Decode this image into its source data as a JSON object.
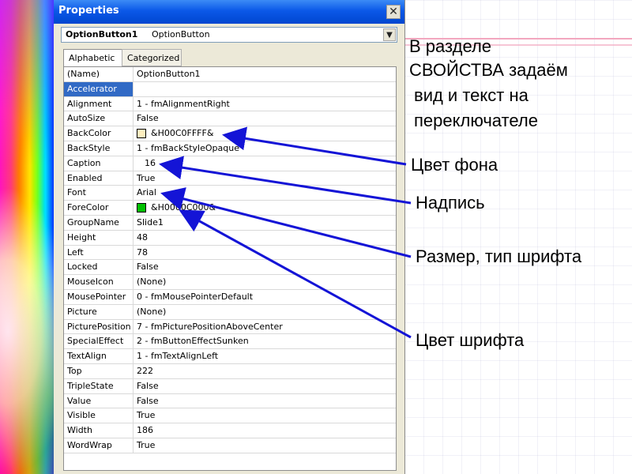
{
  "window": {
    "title": "Properties"
  },
  "combo": {
    "object_name": "OptionButton1",
    "object_type": "OptionButton"
  },
  "tabs": [
    "Alphabetic",
    "Categorized"
  ],
  "properties": [
    {
      "name": "(Name)",
      "value": "OptionButton1"
    },
    {
      "name": "Accelerator",
      "value": ""
    },
    {
      "name": "Alignment",
      "value": "1 - fmAlignmentRight"
    },
    {
      "name": "AutoSize",
      "value": "False"
    },
    {
      "name": "BackColor",
      "value": "&H00C0FFFF&",
      "swatch": "#fff0c0"
    },
    {
      "name": "BackStyle",
      "value": "1 - fmBackStyleOpaque"
    },
    {
      "name": "Caption",
      "value": "16"
    },
    {
      "name": "Enabled",
      "value": "True"
    },
    {
      "name": "Font",
      "value": "Arial"
    },
    {
      "name": "ForeColor",
      "value": "&H0000C000&",
      "swatch": "#00c000"
    },
    {
      "name": "GroupName",
      "value": "Slide1"
    },
    {
      "name": "Height",
      "value": "48"
    },
    {
      "name": "Left",
      "value": "78"
    },
    {
      "name": "Locked",
      "value": "False"
    },
    {
      "name": "MouseIcon",
      "value": "(None)"
    },
    {
      "name": "MousePointer",
      "value": "0 - fmMousePointerDefault"
    },
    {
      "name": "Picture",
      "value": "(None)"
    },
    {
      "name": "PicturePosition",
      "value": "7 - fmPicturePositionAboveCenter"
    },
    {
      "name": "SpecialEffect",
      "value": "2 - fmButtonEffectSunken"
    },
    {
      "name": "TextAlign",
      "value": "1 - fmTextAlignLeft"
    },
    {
      "name": "Top",
      "value": "222"
    },
    {
      "name": "TripleState",
      "value": "False"
    },
    {
      "name": "Value",
      "value": "False"
    },
    {
      "name": "Visible",
      "value": "True"
    },
    {
      "name": "Width",
      "value": "186"
    },
    {
      "name": "WordWrap",
      "value": "True"
    }
  ],
  "annotations": {
    "heading_lines": [
      "В разделе",
      "СВОЙСТВА задаём",
      " вид и текст на",
      " переключателе"
    ],
    "label_backcolor": "Цвет фона",
    "label_caption": "Надпись",
    "label_font": "Размер, тип шрифта",
    "label_forecolor": "Цвет шрифта"
  },
  "colors": {
    "titlebar": "#0b58e8",
    "selection": "#316ac5",
    "arrow": "#1414d6"
  },
  "icons": {
    "close": "close-icon",
    "dropdown": "chevron-down-icon"
  }
}
